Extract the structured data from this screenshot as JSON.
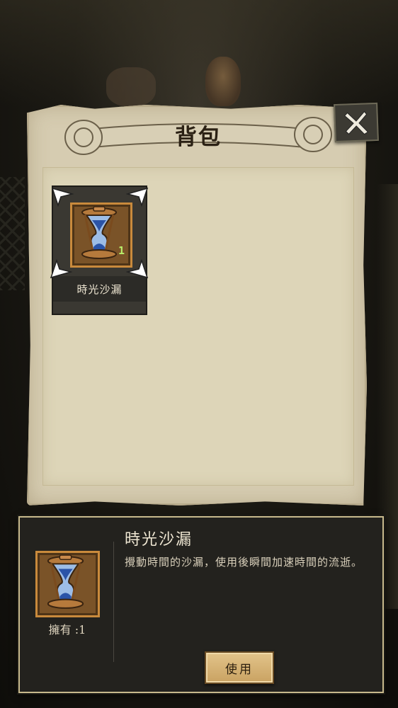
{
  "backpack": {
    "title": "背包",
    "close_icon": "close-x-icon"
  },
  "inventory": {
    "items": [
      {
        "name": "時光沙漏",
        "count": "1",
        "icon": "hourglass-icon"
      }
    ]
  },
  "detail": {
    "title": "時光沙漏",
    "description": "攪動時間的沙漏，使用後瞬間加速時間的流逝。",
    "own_label": "擁有 :1",
    "use_label": "使用",
    "icon": "hourglass-icon"
  },
  "colors": {
    "parchment": "#d6ccb1",
    "panel_dark": "#23221e",
    "frame_gold": "#c98a3c",
    "count_green": "#b9ef6a"
  }
}
